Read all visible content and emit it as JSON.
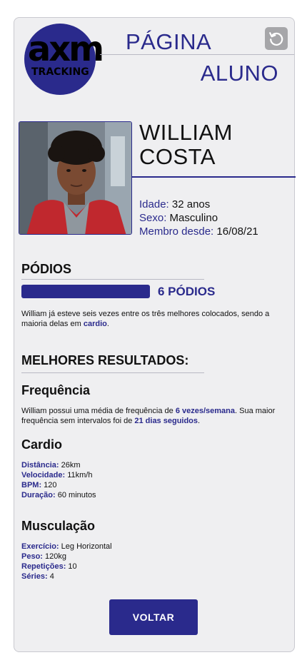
{
  "header": {
    "logo_main": "axm",
    "logo_sub": "TRACKING",
    "title_line1": "PÁGINA",
    "title_line2": "ALUNO",
    "reload_icon": "reload-icon"
  },
  "profile": {
    "name_first": "WILLIAM",
    "name_last": "COSTA",
    "age_label": "Idade:",
    "age_value": "32 anos",
    "sex_label": "Sexo:",
    "sex_value": "Masculino",
    "member_label": "Membro desde:",
    "member_value": "16/08/21"
  },
  "podiums": {
    "title": "PÓDIOS",
    "count_text": "6 PÓDIOS",
    "count": 6,
    "desc_1": "William já esteve seis vezes entre os três melhores colocados, sendo a maioria delas em ",
    "desc_hl": "cardio",
    "desc_2": "."
  },
  "best_results": {
    "title": "MELHORES RESULTADOS:",
    "frequency": {
      "title": "Frequência",
      "text_1": "William possui uma média de frequência de ",
      "hl_1": "6 vezes/semana",
      "text_2": ". Sua maior frequência sem intervalos foi de ",
      "hl_2": "21 dias seguidos",
      "text_3": "."
    },
    "cardio": {
      "title": "Cardio",
      "items": [
        {
          "label": "Distância:",
          "value": "26km"
        },
        {
          "label": "Velocidade:",
          "value": "11km/h"
        },
        {
          "label": "BPM:",
          "value": "120"
        },
        {
          "label": "Duração:",
          "value": "60 minutos"
        }
      ]
    },
    "musculacao": {
      "title": "Musculação",
      "items": [
        {
          "label": "Exercício:",
          "value": "Leg Horizontal"
        },
        {
          "label": "Peso:",
          "value": "120kg"
        },
        {
          "label": "Repetições:",
          "value": "10"
        },
        {
          "label": "Séries:",
          "value": "4"
        }
      ]
    }
  },
  "actions": {
    "back_label": "VOLTAR"
  },
  "colors": {
    "accent": "#2a2a8c",
    "card_bg": "#efeff1"
  }
}
